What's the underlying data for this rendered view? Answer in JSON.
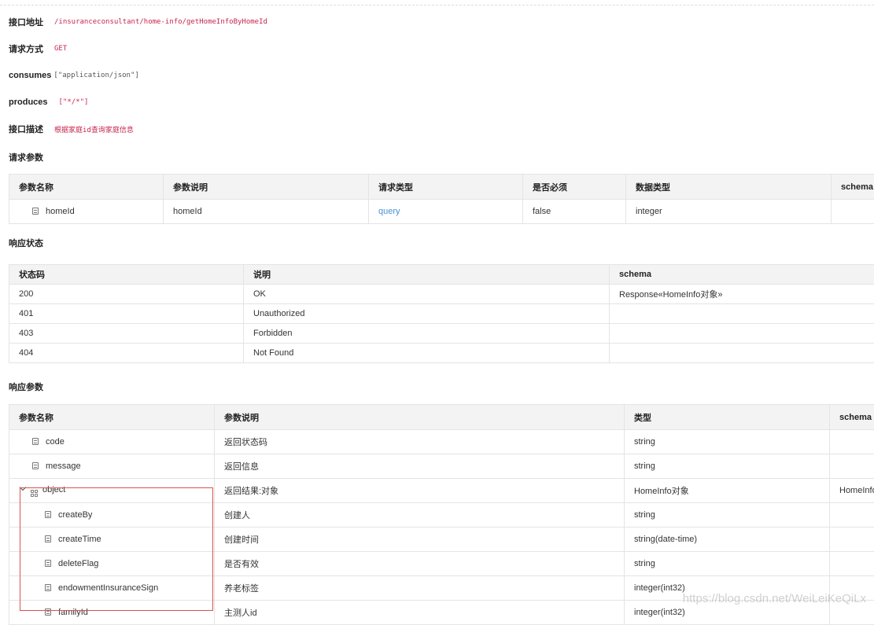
{
  "api_info": {
    "address_label": "接口地址",
    "address": "/insuranceconsultant/home-info/getHomeInfoByHomeId",
    "method_label": "请求方式",
    "method": "GET",
    "consumes_label": "consumes",
    "consumes": "[\"application/json\"]",
    "produces_label": "produces",
    "produces": "[\"*/*\"]",
    "desc_label": "接口描述",
    "desc": "根据家庭id查询家庭信息"
  },
  "request_params": {
    "title": "请求参数",
    "headers": [
      "参数名称",
      "参数说明",
      "请求类型",
      "是否必须",
      "数据类型",
      "schema"
    ],
    "rows": [
      {
        "name": "homeId",
        "desc": "homeId",
        "in": "query",
        "required": "false",
        "type": "integer",
        "schema": ""
      }
    ]
  },
  "response_status": {
    "title": "响应状态",
    "headers": [
      "状态码",
      "说明",
      "schema"
    ],
    "rows": [
      {
        "code": "200",
        "desc": "OK",
        "schema": "Response«HomeInfo对象»"
      },
      {
        "code": "401",
        "desc": "Unauthorized",
        "schema": ""
      },
      {
        "code": "403",
        "desc": "Forbidden",
        "schema": ""
      },
      {
        "code": "404",
        "desc": "Not Found",
        "schema": ""
      }
    ]
  },
  "response_params": {
    "title": "响应参数",
    "headers": [
      "参数名称",
      "参数说明",
      "类型",
      "schema"
    ],
    "rows": [
      {
        "name": "code",
        "desc": "返回状态码",
        "type": "string",
        "schema": ""
      },
      {
        "name": "message",
        "desc": "返回信息",
        "type": "string",
        "schema": ""
      },
      {
        "name": "object",
        "desc": "返回结果:对象",
        "type": "HomeInfo对象",
        "schema": "HomeInfo"
      },
      {
        "name": "createBy",
        "desc": "创建人",
        "type": "string",
        "schema": ""
      },
      {
        "name": "createTime",
        "desc": "创建时间",
        "type": "string(date-time)",
        "schema": ""
      },
      {
        "name": "deleteFlag",
        "desc": "是否有效",
        "type": "string",
        "schema": ""
      },
      {
        "name": "endowmentInsuranceSign",
        "desc": "养老标签",
        "type": "integer(int32)",
        "schema": ""
      },
      {
        "name": "familyId",
        "desc": "主测人id",
        "type": "integer(int32)",
        "schema": ""
      }
    ]
  },
  "watermark": "https://blog.csdn.net/WeiLeiKeQiLx"
}
